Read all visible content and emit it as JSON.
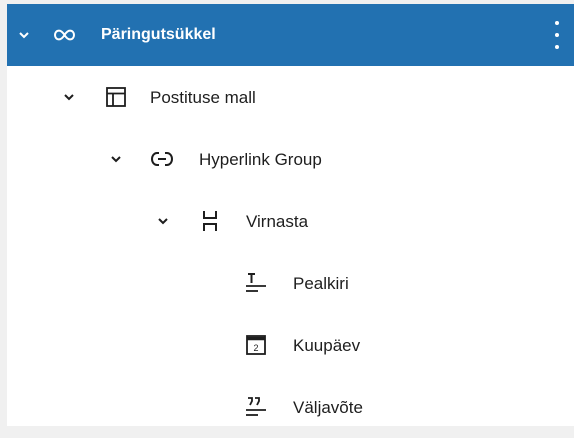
{
  "tree": {
    "items": [
      {
        "label": "Päringutsükkel",
        "icon": "loop-icon",
        "expanded": true,
        "selected": true
      },
      {
        "label": "Postituse mall",
        "icon": "template-icon",
        "expanded": true
      },
      {
        "label": "Hyperlink Group",
        "icon": "link-icon",
        "expanded": true
      },
      {
        "label": "Virnasta",
        "icon": "stack-icon",
        "expanded": true
      },
      {
        "label": "Pealkiri",
        "icon": "title-icon"
      },
      {
        "label": "Kuupäev",
        "icon": "date-icon",
        "icon_text": "2"
      },
      {
        "label": "Väljavõte",
        "icon": "excerpt-icon"
      }
    ]
  },
  "colors": {
    "selected_bg": "#2271b1",
    "text": "#1e1e1e",
    "background": "#ffffff"
  }
}
